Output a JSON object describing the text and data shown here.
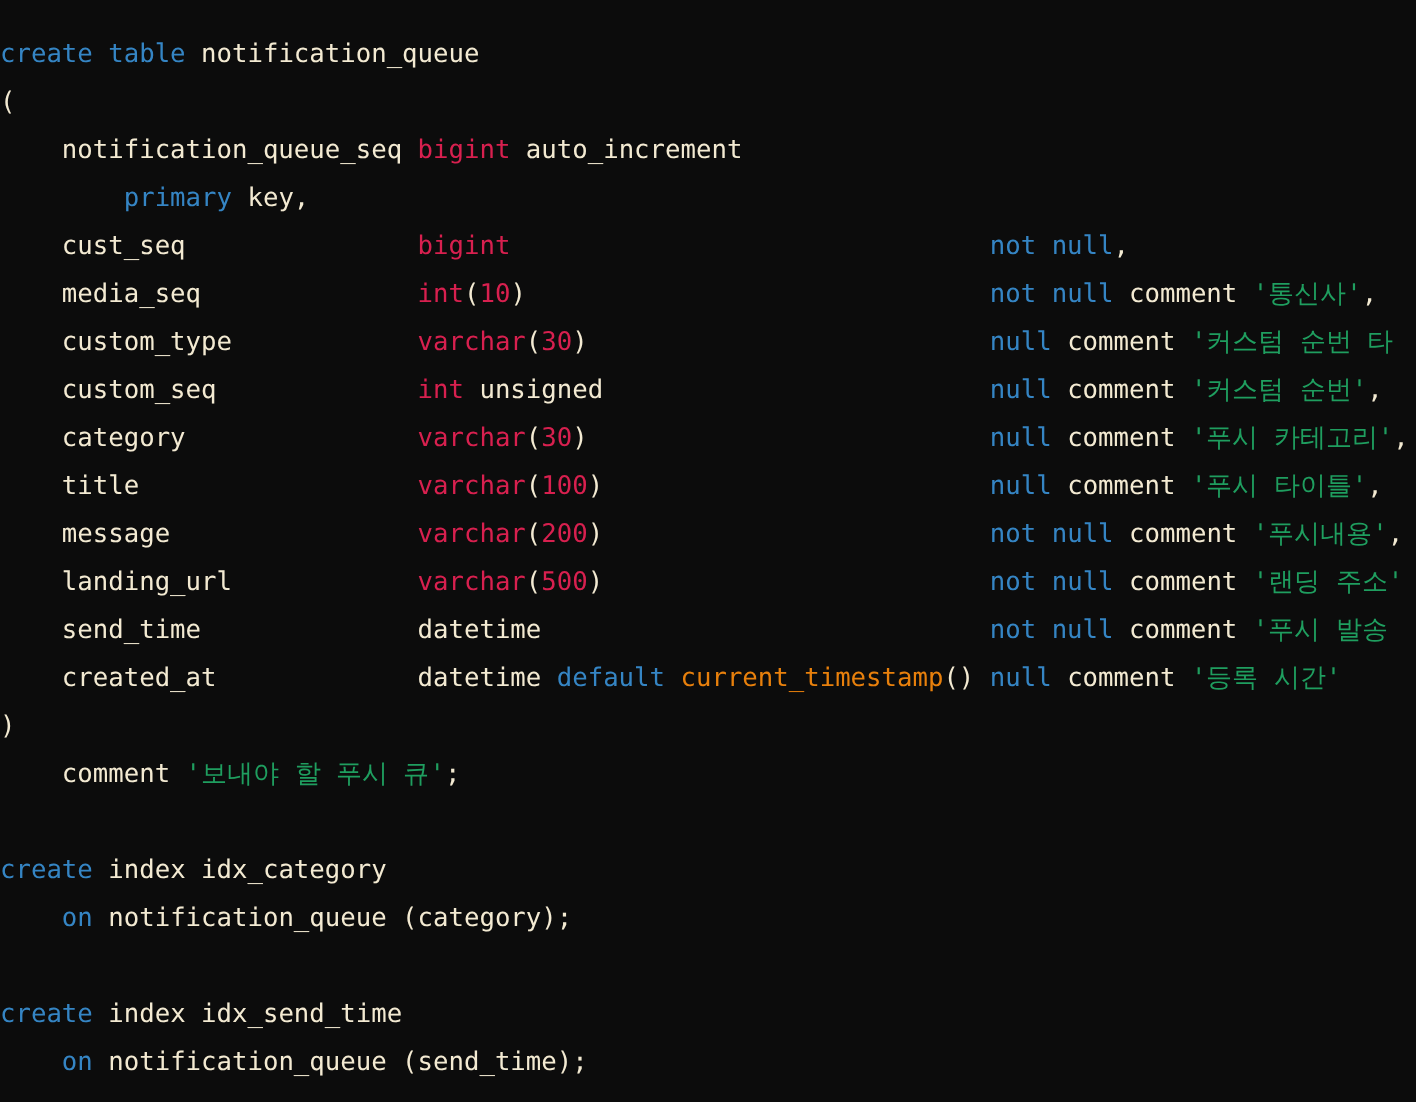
{
  "editor": {
    "lines": [
      {
        "kind": "code",
        "tokens": [
          {
            "kind": "keyword",
            "text": "create table"
          },
          {
            "kind": "plain",
            "text": " notification_queue"
          }
        ]
      },
      {
        "kind": "code",
        "tokens": [
          {
            "kind": "plain",
            "text": "("
          }
        ]
      },
      {
        "kind": "code",
        "tokens": [
          {
            "kind": "plain",
            "text": "    notification_queue_seq "
          },
          {
            "kind": "type",
            "text": "bigint"
          },
          {
            "kind": "plain",
            "text": " auto_increment"
          }
        ]
      },
      {
        "kind": "code",
        "tokens": [
          {
            "kind": "keyword",
            "text": "        primary"
          },
          {
            "kind": "plain",
            "text": " key,"
          }
        ]
      },
      {
        "kind": "code",
        "tokens": [
          {
            "kind": "plain",
            "text": "    cust_seq               "
          },
          {
            "kind": "type",
            "text": "bigint"
          },
          {
            "kind": "keyword",
            "text": "                               not null"
          },
          {
            "kind": "plain",
            "text": ","
          }
        ]
      },
      {
        "kind": "code",
        "tokens": [
          {
            "kind": "plain",
            "text": "    media_seq              "
          },
          {
            "kind": "type",
            "text": "int"
          },
          {
            "kind": "plain",
            "text": "("
          },
          {
            "kind": "number",
            "text": "10"
          },
          {
            "kind": "plain",
            "text": ")                              "
          },
          {
            "kind": "keyword",
            "text": "not null"
          },
          {
            "kind": "plain",
            "text": " comment "
          },
          {
            "kind": "string",
            "text": "'통신사'"
          },
          {
            "kind": "plain",
            "text": ","
          }
        ]
      },
      {
        "kind": "code",
        "tokens": [
          {
            "kind": "plain",
            "text": "    custom_type            "
          },
          {
            "kind": "type",
            "text": "varchar"
          },
          {
            "kind": "plain",
            "text": "("
          },
          {
            "kind": "number",
            "text": "30"
          },
          {
            "kind": "plain",
            "text": ")                          "
          },
          {
            "kind": "keyword",
            "text": "null"
          },
          {
            "kind": "plain",
            "text": " comment "
          },
          {
            "kind": "string",
            "text": "'커스텀 순번 타"
          }
        ]
      },
      {
        "kind": "code",
        "tokens": [
          {
            "kind": "plain",
            "text": "    custom_seq             "
          },
          {
            "kind": "type",
            "text": "int"
          },
          {
            "kind": "plain",
            "text": " unsigned                         "
          },
          {
            "kind": "keyword",
            "text": "null"
          },
          {
            "kind": "plain",
            "text": " comment "
          },
          {
            "kind": "string",
            "text": "'커스텀 순번'"
          },
          {
            "kind": "plain",
            "text": ","
          }
        ]
      },
      {
        "kind": "code",
        "tokens": [
          {
            "kind": "plain",
            "text": "    category               "
          },
          {
            "kind": "type",
            "text": "varchar"
          },
          {
            "kind": "plain",
            "text": "("
          },
          {
            "kind": "number",
            "text": "30"
          },
          {
            "kind": "plain",
            "text": ")                          "
          },
          {
            "kind": "keyword",
            "text": "null"
          },
          {
            "kind": "plain",
            "text": " comment "
          },
          {
            "kind": "string",
            "text": "'푸시 카테고리'"
          },
          {
            "kind": "plain",
            "text": ","
          }
        ]
      },
      {
        "kind": "code",
        "tokens": [
          {
            "kind": "plain",
            "text": "    title                  "
          },
          {
            "kind": "type",
            "text": "varchar"
          },
          {
            "kind": "plain",
            "text": "("
          },
          {
            "kind": "number",
            "text": "100"
          },
          {
            "kind": "plain",
            "text": ")                         "
          },
          {
            "kind": "keyword",
            "text": "null"
          },
          {
            "kind": "plain",
            "text": " comment "
          },
          {
            "kind": "string",
            "text": "'푸시 타이틀'"
          },
          {
            "kind": "plain",
            "text": ","
          }
        ]
      },
      {
        "kind": "code",
        "tokens": [
          {
            "kind": "plain",
            "text": "    message                "
          },
          {
            "kind": "type",
            "text": "varchar"
          },
          {
            "kind": "plain",
            "text": "("
          },
          {
            "kind": "number",
            "text": "200"
          },
          {
            "kind": "plain",
            "text": ")                         "
          },
          {
            "kind": "keyword",
            "text": "not null"
          },
          {
            "kind": "plain",
            "text": " comment "
          },
          {
            "kind": "string",
            "text": "'푸시내용'"
          },
          {
            "kind": "plain",
            "text": ","
          }
        ]
      },
      {
        "kind": "code",
        "tokens": [
          {
            "kind": "plain",
            "text": "    landing_url            "
          },
          {
            "kind": "type",
            "text": "varchar"
          },
          {
            "kind": "plain",
            "text": "("
          },
          {
            "kind": "number",
            "text": "500"
          },
          {
            "kind": "plain",
            "text": ")                         "
          },
          {
            "kind": "keyword",
            "text": "not null"
          },
          {
            "kind": "plain",
            "text": " comment "
          },
          {
            "kind": "string",
            "text": "'랜딩 주소'"
          }
        ]
      },
      {
        "kind": "code",
        "tokens": [
          {
            "kind": "plain",
            "text": "    send_time              datetime                             "
          },
          {
            "kind": "keyword",
            "text": "not null"
          },
          {
            "kind": "plain",
            "text": " comment "
          },
          {
            "kind": "string",
            "text": "'푸시 발송"
          }
        ]
      },
      {
        "kind": "code",
        "tokens": [
          {
            "kind": "plain",
            "text": "    created_at             datetime "
          },
          {
            "kind": "keyword",
            "text": "default"
          },
          {
            "kind": "function",
            "text": " current_timestamp"
          },
          {
            "kind": "plain",
            "text": "() "
          },
          {
            "kind": "keyword",
            "text": "null"
          },
          {
            "kind": "plain",
            "text": " comment "
          },
          {
            "kind": "string",
            "text": "'등록 시간'"
          }
        ]
      },
      {
        "kind": "code",
        "tokens": [
          {
            "kind": "plain",
            "text": ")"
          }
        ]
      },
      {
        "kind": "code",
        "tokens": [
          {
            "kind": "plain",
            "text": "    comment "
          },
          {
            "kind": "string",
            "text": "'보내야 할 푸시 큐'"
          },
          {
            "kind": "plain",
            "text": ";"
          }
        ]
      },
      {
        "kind": "blank"
      },
      {
        "kind": "code",
        "tokens": [
          {
            "kind": "keyword",
            "text": "create"
          },
          {
            "kind": "plain",
            "text": " index idx_category"
          }
        ]
      },
      {
        "kind": "code",
        "tokens": [
          {
            "kind": "keyword",
            "text": "    on"
          },
          {
            "kind": "plain",
            "text": " notification_queue (category);"
          }
        ]
      },
      {
        "kind": "blank"
      },
      {
        "kind": "code",
        "tokens": [
          {
            "kind": "keyword",
            "text": "create"
          },
          {
            "kind": "plain",
            "text": " index idx_send_time"
          }
        ]
      },
      {
        "kind": "code",
        "tokens": [
          {
            "kind": "keyword",
            "text": "    on"
          },
          {
            "kind": "plain",
            "text": " notification_queue (send_time);"
          }
        ]
      }
    ]
  }
}
